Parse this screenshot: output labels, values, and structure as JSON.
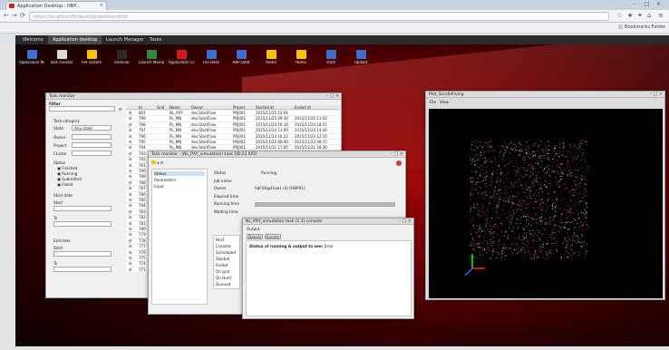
{
  "browser": {
    "tab_title": "Application Desktop - HBP...",
    "tab_close": "×",
    "url": "https://localhost/fit/desktop/desktop.html",
    "back_glyph": "←",
    "forward_glyph": "→",
    "reload_glyph": "⟳",
    "window_controls": [
      "–",
      "□",
      "×"
    ],
    "toolbar_glyphs": [
      "☆",
      "★",
      "✦",
      "⌂",
      "≡"
    ],
    "bookmark_other": "Bookmarks Folder"
  },
  "appnav": {
    "items": [
      "Welcome",
      "Application desktop",
      "Launch Manager",
      "Tasks"
    ],
    "active_index": 1
  },
  "desktop_icons": [
    {
      "label": "Application Manager",
      "color": "#3b6fd6"
    },
    {
      "label": "Task monitor",
      "color": "#dadada"
    },
    {
      "label": "File system",
      "color": "#f5c400"
    },
    {
      "label": "Terminal",
      "color": "#2b2b2b"
    },
    {
      "label": "Launch Manager",
      "color": "#2e8b3e"
    },
    {
      "label": "Application Catalogue",
      "color": "#d21b1b"
    },
    {
      "label": "File Desk",
      "color": "#3a6fd0"
    },
    {
      "label": "HBP Data",
      "color": "#3a6fd0"
    },
    {
      "label": "Home",
      "color": "#f5c400"
    },
    {
      "label": "Home",
      "color": "#f5c400"
    },
    {
      "label": "Trash",
      "color": "#3a6fd0"
    },
    {
      "label": "Upload",
      "color": "#3a6fd0"
    }
  ],
  "task_monitor": {
    "title": "Task monitor",
    "filter_label": "Filter",
    "filter_value": "",
    "form": {
      "task_category": "Task category",
      "state_label": "State",
      "state_value": "Any state",
      "owner_label": "Owner",
      "project_label": "Project",
      "cluster_label": "Cluster",
      "status_label": "Status",
      "status_options": [
        "Finished",
        "Running",
        "Submitted",
        "Failed"
      ],
      "start_date": "Start date",
      "start_from": "Start",
      "start_to": "To",
      "end_date": "End date",
      "end_from": "Start",
      "end_to": "To"
    },
    "columns": [
      "",
      "Id",
      "Grid",
      "Name",
      "Owner",
      "Project",
      "Started at",
      "Ended at"
    ],
    "rows": [
      [
        "",
        "801",
        "",
        "NL_PXY",
        "dev.StartFlow",
        "PRJ001",
        "2015/11/25 12:04",
        ""
      ],
      [
        "",
        "799",
        "",
        "PL_MN",
        "dev.StartFlow",
        "PRJ001",
        "2015/11/25 09:30",
        "2015/11/25 11:02"
      ],
      [
        "",
        "798",
        "",
        "PL_MN",
        "dev.StartFlow",
        "PRJ001",
        "2015/11/24 16:18",
        "2015/11/24 18:51"
      ],
      [
        "",
        "797",
        "",
        "PL_MN",
        "dev.StartFlow",
        "PRJ001",
        "2015/11/24 13:09",
        "2015/11/24 14:44"
      ],
      [
        "",
        "796",
        "",
        "PL_MN",
        "dev.StartFlow",
        "PRJ001",
        "2015/11/23 10:22",
        "2015/11/23 12:10"
      ],
      [
        "",
        "795",
        "",
        "PL_MN",
        "dev.StartFlow",
        "PRJ001",
        "2015/11/22 08:40",
        "2015/11/22 09:15"
      ],
      [
        "",
        "794",
        "",
        "PL_MN",
        "dev.StartFlow",
        "PRJ001",
        "2015/11/21 17:05",
        "2015/11/21 18:30"
      ],
      [
        "",
        "793",
        "",
        "PL_MN",
        "dev.StartFlow",
        "PRJ001",
        "2015/11/21 11:48",
        "2015/11/21 12:33"
      ],
      [
        "",
        "792",
        "",
        "PL_MN",
        "dev.StartFlow",
        "PRJ001",
        "2015/11/20 15:27",
        "2015/11/20 16:02"
      ],
      [
        "",
        "791",
        "",
        "PL_MN",
        "dev.StartFlow",
        "PRJ001",
        "2015/11/20 09:11",
        "2015/11/20 10:40"
      ]
    ],
    "more_ids": [
      "790",
      "789",
      "788",
      "787",
      "786",
      "785",
      "784",
      "783",
      "782",
      "781",
      "780",
      "779",
      "778",
      "777",
      "776",
      "775",
      "774",
      "773"
    ]
  },
  "task_detail": {
    "title": "Task monitor - (NL_PXY_simulation) task [ID:23 IUD]",
    "tree": [
      "Status",
      "Parameters",
      "Input"
    ],
    "rows": [
      {
        "label": "Status",
        "value": "Running"
      },
      {
        "label": "Job name",
        "value": ""
      },
      {
        "label": "Owner",
        "value": "hbf.SA@Flow1 (4) [HBP01]"
      },
      {
        "label": "Elapsed time",
        "value": ""
      },
      {
        "label": "Running time",
        "value": ""
      },
      {
        "label": "Waiting time",
        "value": ""
      }
    ],
    "progress": 1.0,
    "left_menu": [
      "Host",
      "Created",
      "Scheduled",
      "Started",
      "Ended",
      "On grid",
      "On Hold",
      "Queued"
    ]
  },
  "console": {
    "title": "NL_PXY_simulation task (1.1) console",
    "section": "Output",
    "tabs": [
      "Details",
      "Events"
    ],
    "message_label": "Status of running & output to see:",
    "message_value": "Error"
  },
  "plot": {
    "title": "Plot_Scrolldriving",
    "menu": [
      "File",
      "View"
    ],
    "ctl": "– □ ×"
  }
}
